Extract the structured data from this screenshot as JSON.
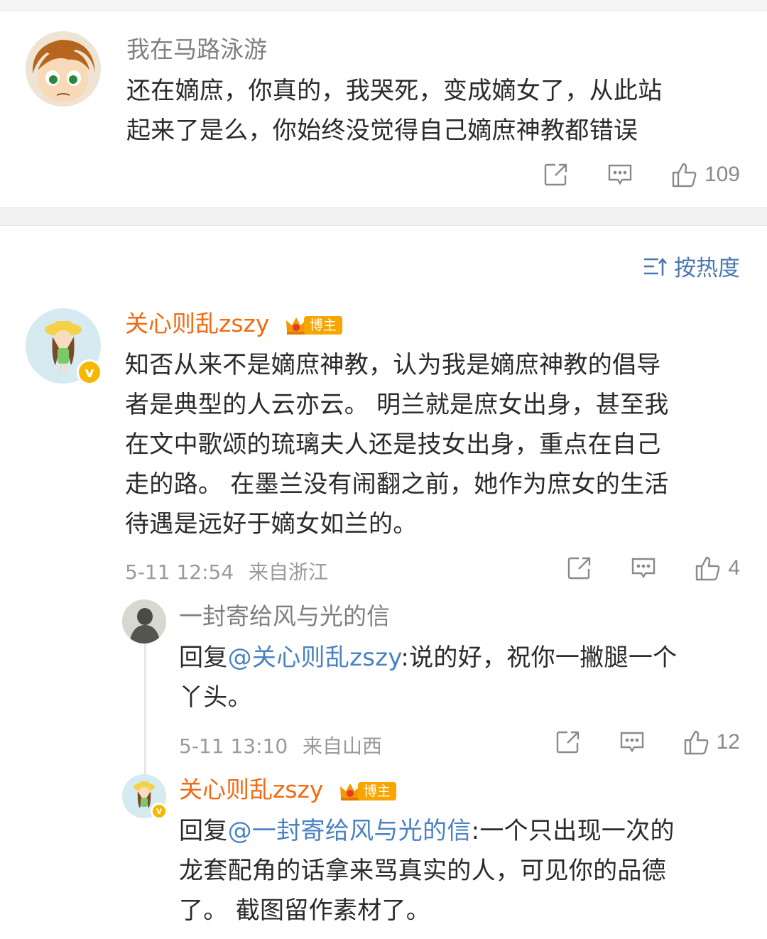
{
  "comment1": {
    "username": "我在马路泳游",
    "text_line1": "还在嫡庶，你真的，我哭死，变成嫡女了，从此站",
    "text_line2": "起来了是么，你始终没觉得自己嫡庶神教都错误",
    "likes": "109"
  },
  "sort_label": "按热度",
  "comment2": {
    "username": "关心则乱zszy",
    "badge": "博主",
    "lines": [
      "知否从来不是嫡庶神教，认为我是嫡庶神教的倡导",
      "者是典型的人云亦云。 明兰就是庶女出身，甚至我",
      "在文中歌颂的琉璃夫人还是技女出身，重点在自己",
      "走的路。 在墨兰没有闹翻之前，她作为庶女的生活",
      "待遇是远好于嫡女如兰的。"
    ],
    "time": "5-11 12:54",
    "location": "来自浙江",
    "likes": "4"
  },
  "reply1": {
    "username": "一封寄给风与光的信",
    "reply_prefix": "回复",
    "mention": "@关心则乱zszy",
    "text_after": ":说的好，祝你一撇腿一个",
    "text_line2": "丫头。",
    "time": "5-11 13:10",
    "location": "来自山西",
    "likes": "12"
  },
  "reply2": {
    "username": "关心则乱zszy",
    "badge": "博主",
    "reply_prefix": "回复",
    "mention": "@一封寄给风与光的信",
    "text_after": ":一个只出现一次的",
    "text_line2": "龙套配角的话拿来骂真实的人，可见你的品德",
    "text_line3": "了。 截图留作素材了。"
  },
  "colors": {
    "accent_orange": "#f26a11",
    "mention_blue": "#4a82c2",
    "sort_blue": "#4a78b0"
  }
}
